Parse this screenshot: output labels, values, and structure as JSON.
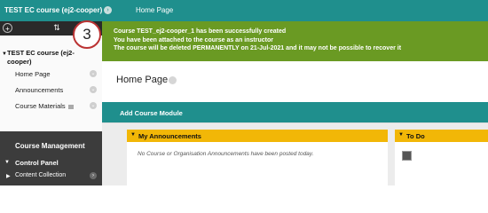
{
  "header": {
    "course_title": "TEST EC course (ej2-cooper)",
    "breadcrumb": "Home Page"
  },
  "sidebar": {
    "title": "TEST EC course (ej2-cooper)",
    "items": [
      {
        "label": "Home Page"
      },
      {
        "label": "Announcements"
      },
      {
        "label": "Course Materials"
      }
    ],
    "management": {
      "title": "Course Management",
      "control_panel": "Control Panel",
      "content_collection": "Content Collection"
    }
  },
  "callout": {
    "number": "3"
  },
  "success_message": [
    "Course TEST_ej2-cooper_1 has been successfully created",
    "You have been attached to the course as an instructor",
    "The course will be deleted PERMANENTLY on 21-Jul-2021 and it may not be possible to recover it"
  ],
  "page": {
    "title": "Home Page",
    "add_module_label": "Add Course Module"
  },
  "modules": {
    "announcements": {
      "title": "My Announcements",
      "body": "No Course or Organisation Announcements have been posted today."
    },
    "todo": {
      "title": "To Do"
    }
  },
  "colors": {
    "teal": "#1f8f8d",
    "success_green": "#6a9a23",
    "module_header": "#f2b707",
    "management_bg": "#3c3c3c"
  }
}
